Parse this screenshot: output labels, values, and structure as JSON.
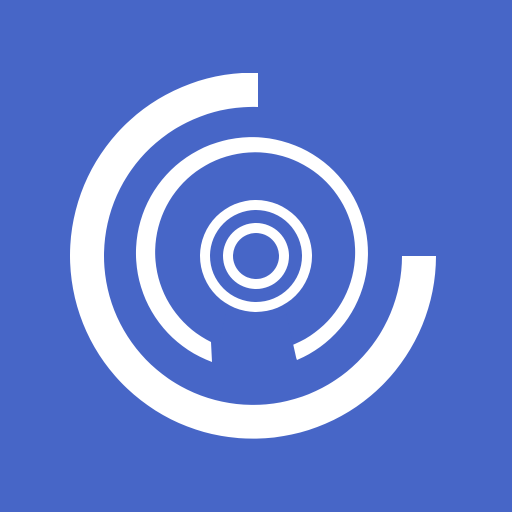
{
  "app_icon": {
    "icon_name": "concentric-rings-signal-icon",
    "colors": {
      "background": "#4766C7",
      "foreground": "#FFFFFF"
    }
  }
}
